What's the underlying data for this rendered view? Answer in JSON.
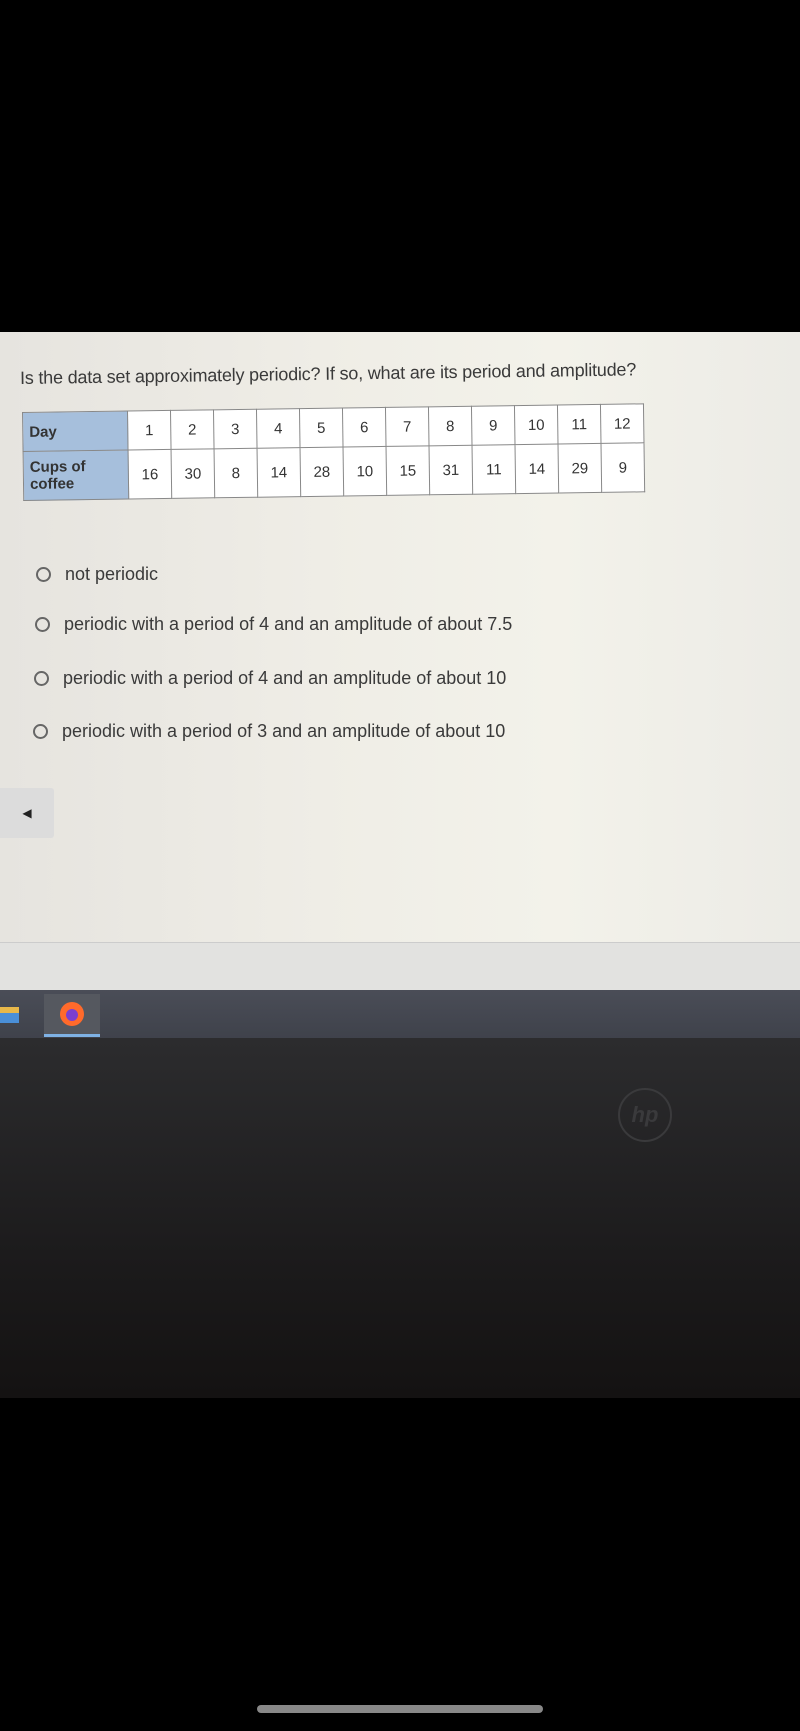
{
  "question": "Is the data set approximately periodic? If so, what are its period and amplitude?",
  "table": {
    "row_headers": [
      "Day",
      "Cups of coffee"
    ],
    "day": [
      "1",
      "2",
      "3",
      "4",
      "5",
      "6",
      "7",
      "8",
      "9",
      "10",
      "11",
      "12"
    ],
    "cups": [
      "16",
      "30",
      "8",
      "14",
      "28",
      "10",
      "15",
      "31",
      "11",
      "14",
      "29",
      "9"
    ]
  },
  "options": [
    "not periodic",
    "periodic with a period of 4 and an amplitude of about 7.5",
    "periodic with a period of 4 and an amplitude of about 10",
    "periodic with a period of 3 and an amplitude of about 10"
  ],
  "back_button": "◀",
  "taskbar": {
    "items": [
      "file-explorer-icon",
      "firefox-icon"
    ]
  },
  "colors": {
    "header_cell": "#a6bfdc",
    "taskbar": "#45484f"
  }
}
